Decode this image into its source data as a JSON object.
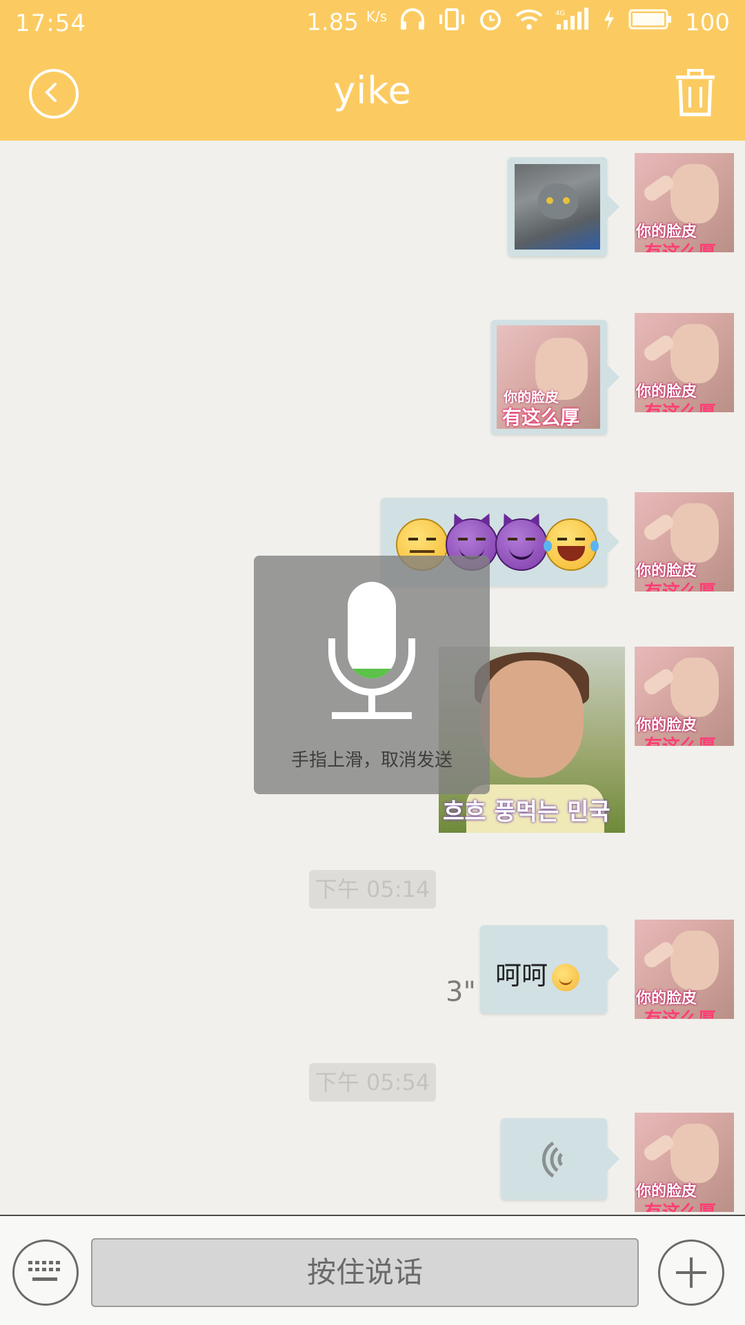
{
  "status_bar": {
    "time": "17:54",
    "speed": "1.85",
    "speed_unit": "K/s",
    "battery": "100"
  },
  "header": {
    "title": "yike",
    "colors": {
      "bar": "#fbcb62",
      "text": "#ffffff"
    }
  },
  "messages": {
    "ts1": "下午 05:14",
    "ts2": "下午 05:54",
    "text_message": "呵呵",
    "voice_duration": "3\"",
    "kid_caption_1": "你的脸皮",
    "kid_caption_2": "有这么厚",
    "gif_caption": "흐흐 풍먹는 민국이",
    "avatar_caption_1": "你的脸皮",
    "avatar_caption_2": "有这么厚"
  },
  "recording": {
    "hint": "手指上滑，取消发送"
  },
  "input_bar": {
    "hold_to_talk": "按住说话"
  },
  "icons": [
    "back-icon",
    "trash-icon",
    "mic-icon",
    "voice-wave-icon",
    "keyboard-icon",
    "plus-icon"
  ]
}
